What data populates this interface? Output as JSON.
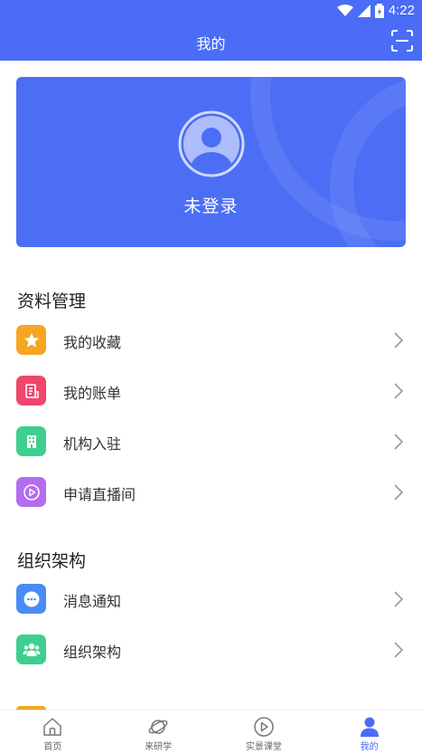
{
  "status": {
    "time": "4:22"
  },
  "header": {
    "title": "我的"
  },
  "profile": {
    "login_text": "未登录"
  },
  "sections": [
    {
      "title": "资料管理",
      "items": [
        {
          "label": "我的收藏",
          "icon": "star-icon",
          "color": "#f5a623"
        },
        {
          "label": "我的账单",
          "icon": "bill-icon",
          "color": "#f0466b"
        },
        {
          "label": "机构入驻",
          "icon": "building-icon",
          "color": "#3ecf8e"
        },
        {
          "label": "申请直播间",
          "icon": "play-icon",
          "color": "#b46cf0"
        }
      ]
    },
    {
      "title": "组织架构",
      "items": [
        {
          "label": "消息通知",
          "icon": "message-icon",
          "color": "#4a8cf7"
        },
        {
          "label": "组织架构",
          "icon": "group-icon",
          "color": "#3ecf8e"
        }
      ]
    }
  ],
  "tabs": [
    {
      "label": "首页",
      "icon": "home-icon"
    },
    {
      "label": "来研学",
      "icon": "planet-icon"
    },
    {
      "label": "实景课堂",
      "icon": "play-circle-icon"
    },
    {
      "label": "我的",
      "icon": "user-icon",
      "active": true
    }
  ],
  "colors": {
    "primary": "#4a6cf7",
    "card": "#4c6ef5"
  }
}
